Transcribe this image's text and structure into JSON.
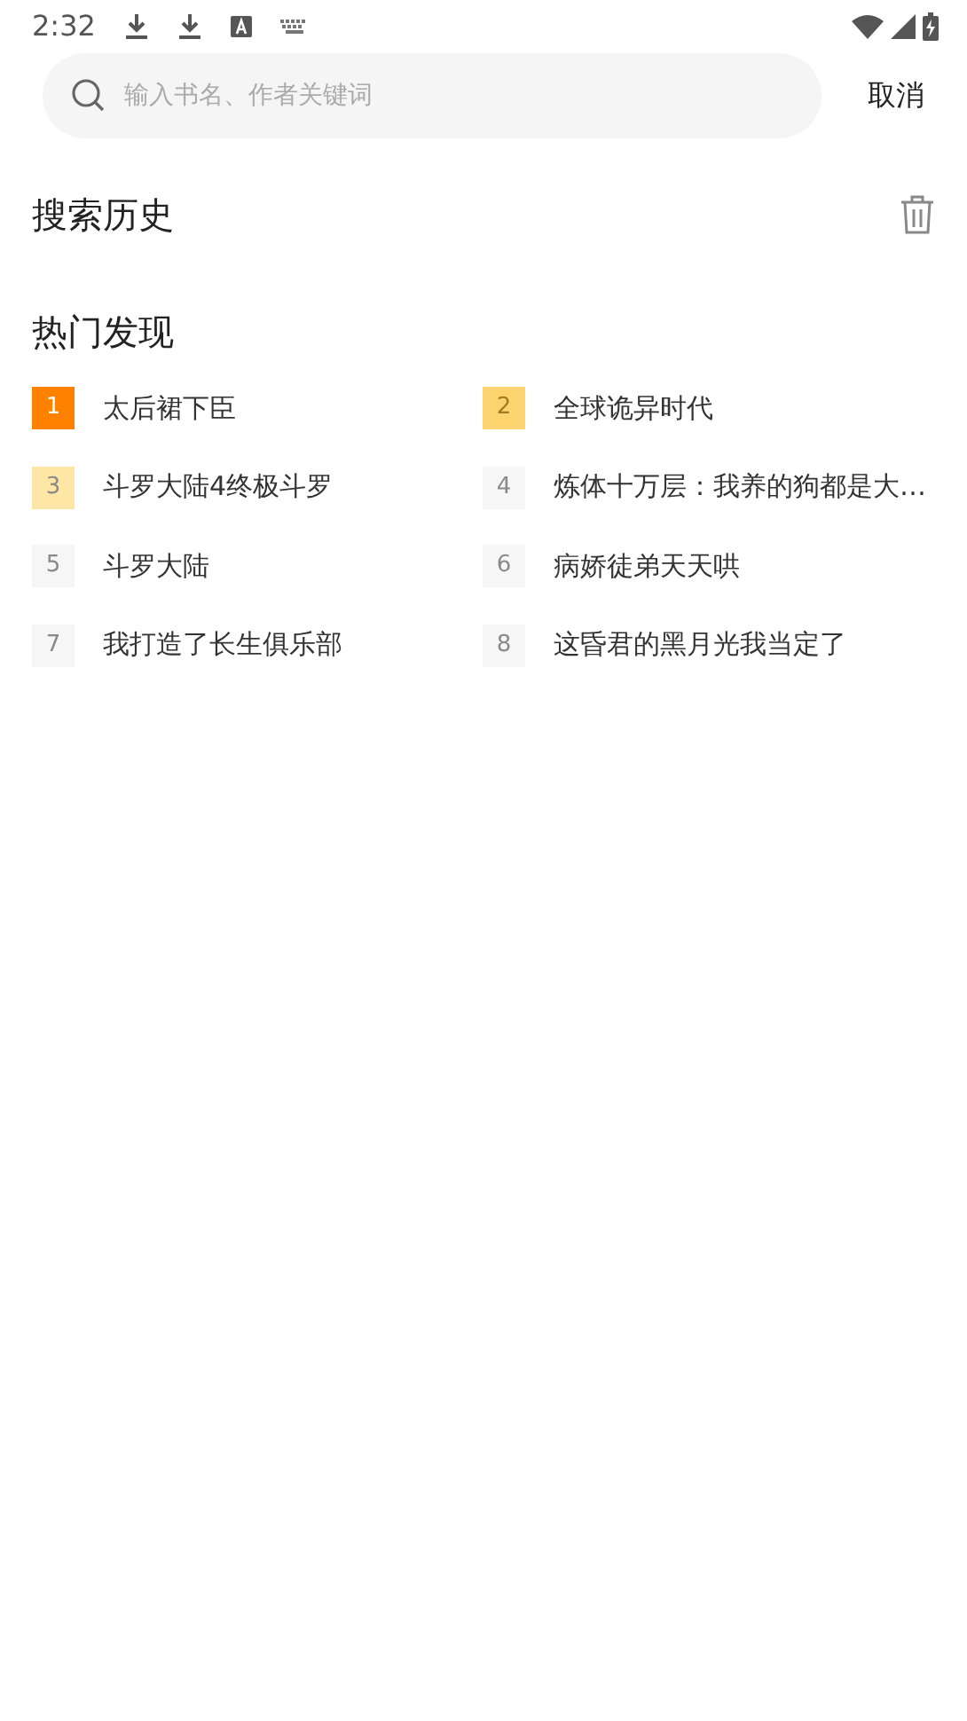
{
  "status_bar": {
    "time": "2:32"
  },
  "search": {
    "placeholder": "输入书名、作者关键词",
    "cancel": "取消"
  },
  "history": {
    "title": "搜索历史"
  },
  "hot": {
    "title": "热门发现",
    "items": [
      {
        "rank": "1",
        "title": "太后裙下臣",
        "color": "#ff8100"
      },
      {
        "rank": "2",
        "title": "全球诡异时代",
        "color": "#fdd36f"
      },
      {
        "rank": "3",
        "title": "斗罗大陆4终极斗罗",
        "color": "#fee6a7"
      },
      {
        "rank": "4",
        "title": "炼体十万层：我养的狗都是大…",
        "color": "#f6f6f6"
      },
      {
        "rank": "5",
        "title": "斗罗大陆",
        "color": "#f6f6f6"
      },
      {
        "rank": "6",
        "title": "病娇徒弟天天哄",
        "color": "#f6f6f6"
      },
      {
        "rank": "7",
        "title": "我打造了长生俱乐部",
        "color": "#f6f6f6"
      },
      {
        "rank": "8",
        "title": "这昏君的黑月光我当定了",
        "color": "#f6f6f6"
      }
    ]
  }
}
